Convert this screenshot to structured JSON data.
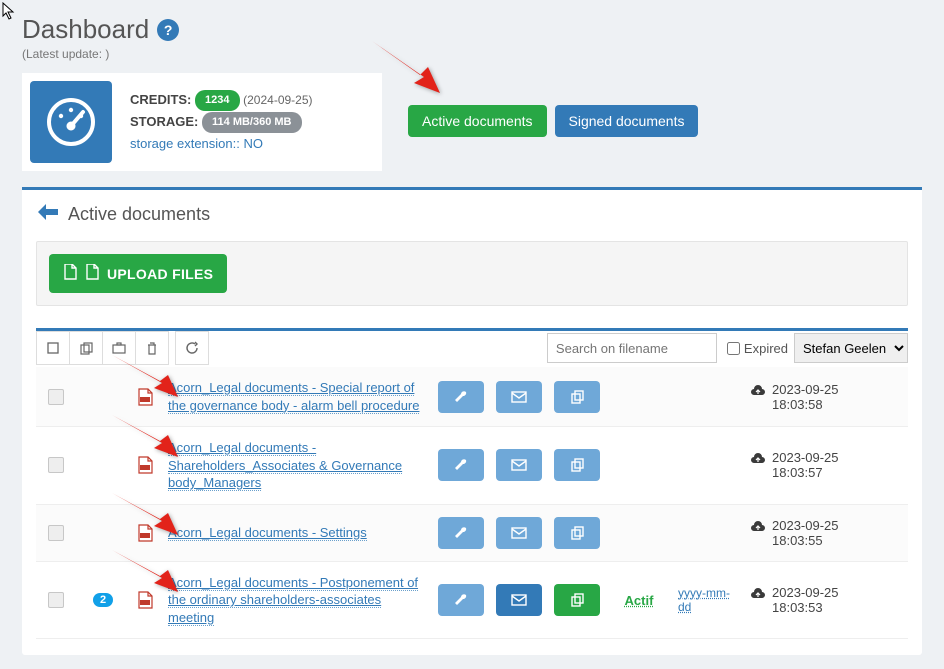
{
  "header": {
    "title": "Dashboard",
    "latest_update_label": "(Latest update: )"
  },
  "info": {
    "credits_label": "CREDITS:",
    "credits_value": "1234",
    "credits_date": "(2024-09-25)",
    "storage_label": "STORAGE:",
    "storage_value": "114 MB/360 MB",
    "storage_ext_label": "storage extension:: NO"
  },
  "top_buttons": {
    "active": "Active documents",
    "signed": "Signed documents"
  },
  "panel": {
    "title": "Active documents",
    "upload_label": "UPLOAD FILES"
  },
  "toolbar": {
    "search_placeholder": "Search on filename",
    "expired_label": "Expired",
    "user_selected": "Stefan Geelen"
  },
  "rows": [
    {
      "name": "Acorn_Legal documents - Special report of the governance body - alarm bell procedure",
      "count": null,
      "status": "",
      "date": "",
      "uploaded": "2023-09-25 18:03:58",
      "copy_green": false
    },
    {
      "name": "Acorn_Legal documents - Shareholders_Associates & Governance body_Managers",
      "count": null,
      "status": "",
      "date": "",
      "uploaded": "2023-09-25 18:03:57",
      "copy_green": false
    },
    {
      "name": "Acorn_Legal documents - Settings",
      "count": null,
      "status": "",
      "date": "",
      "uploaded": "2023-09-25 18:03:55",
      "copy_green": false
    },
    {
      "name": "Acorn_Legal documents - Postponement of the ordinary shareholders-associates meeting",
      "count": "2",
      "status": "Actif",
      "date": "yyyy-mm-dd",
      "uploaded": "2023-09-25 18:03:53",
      "copy_green": true
    }
  ]
}
